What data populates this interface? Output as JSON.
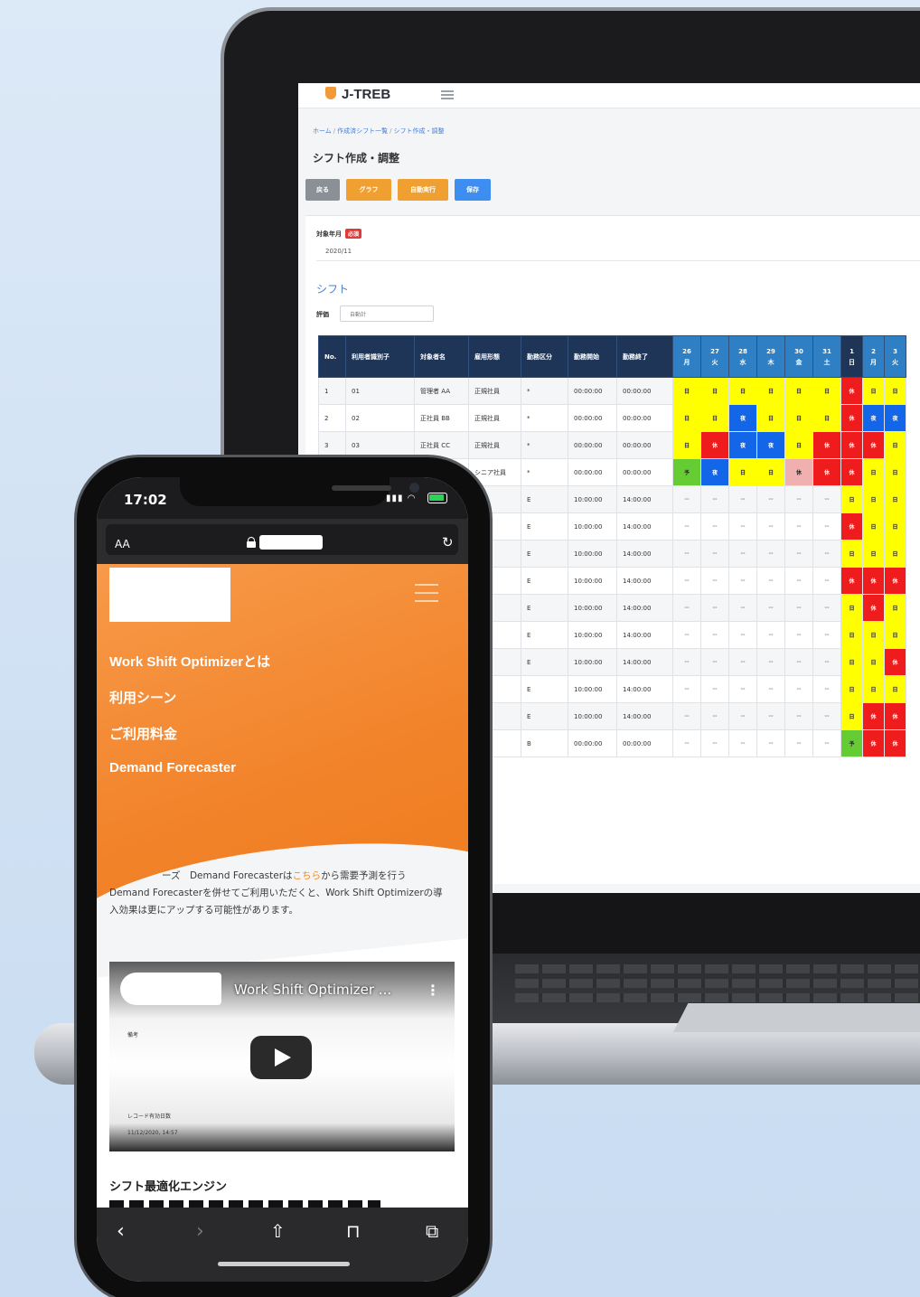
{
  "laptop": {
    "brand": "J-TREB",
    "breadcrumb": [
      "ホーム",
      "作成済シフト一覧",
      "シフト作成・調整"
    ],
    "page_title": "シフト作成・調整",
    "buttons": {
      "back": "戻る",
      "graph": "グラフ",
      "auto": "自動実行",
      "save": "保存"
    },
    "target_month_label": "対象年月",
    "required_badge": "必須",
    "target_month_value": "2020/11",
    "section_title": "シフト",
    "eval_label": "評価",
    "eval_placeholder": "自動計",
    "table": {
      "headers": [
        "No.",
        "利用者識別子",
        "対象者名",
        "雇用形態",
        "勤務区分",
        "勤務開始",
        "勤務終了"
      ],
      "days": [
        {
          "d": "26",
          "w": "月"
        },
        {
          "d": "27",
          "w": "火"
        },
        {
          "d": "28",
          "w": "水"
        },
        {
          "d": "29",
          "w": "木"
        },
        {
          "d": "30",
          "w": "金"
        },
        {
          "d": "31",
          "w": "土"
        },
        {
          "d": "1",
          "w": "日"
        },
        {
          "d": "2",
          "w": "月"
        },
        {
          "d": "3",
          "w": "火"
        }
      ],
      "rows": [
        {
          "no": "1",
          "id": "01",
          "name": "管理者 AA",
          "type": "正規社員",
          "div": "*",
          "start": "00:00:00",
          "end": "00:00:00"
        },
        {
          "no": "2",
          "id": "02",
          "name": "正社員 BB",
          "type": "正規社員",
          "div": "*",
          "start": "00:00:00",
          "end": "00:00:00"
        },
        {
          "no": "3",
          "id": "03",
          "name": "正社員 CC",
          "type": "正規社員",
          "div": "*",
          "start": "00:00:00",
          "end": "00:00:00"
        },
        {
          "no": "",
          "id": "",
          "name": "",
          "type": "シニア社員",
          "div": "*",
          "start": "00:00:00",
          "end": "00:00:00"
        },
        {
          "no": "",
          "id": "",
          "name": "",
          "type": "ート",
          "div": "E",
          "start": "10:00:00",
          "end": "14:00:00"
        },
        {
          "no": "",
          "id": "",
          "name": "",
          "type": "ート",
          "div": "E",
          "start": "10:00:00",
          "end": "14:00:00"
        },
        {
          "no": "",
          "id": "",
          "name": "",
          "type": "ート",
          "div": "E",
          "start": "10:00:00",
          "end": "14:00:00"
        },
        {
          "no": "",
          "id": "",
          "name": "",
          "type": "ート",
          "div": "E",
          "start": "10:00:00",
          "end": "14:00:00"
        },
        {
          "no": "",
          "id": "",
          "name": "",
          "type": "ート",
          "div": "E",
          "start": "10:00:00",
          "end": "14:00:00"
        },
        {
          "no": "",
          "id": "",
          "name": "",
          "type": "ート",
          "div": "E",
          "start": "10:00:00",
          "end": "14:00:00"
        },
        {
          "no": "",
          "id": "",
          "name": "",
          "type": "ト",
          "div": "E",
          "start": "10:00:00",
          "end": "14:00:00"
        },
        {
          "no": "",
          "id": "",
          "name": "",
          "type": "ト",
          "div": "E",
          "start": "10:00:00",
          "end": "14:00:00"
        },
        {
          "no": "",
          "id": "",
          "name": "",
          "type": "ト",
          "div": "E",
          "start": "10:00:00",
          "end": "14:00:00"
        },
        {
          "no": "",
          "id": "",
          "name": "",
          "type": "",
          "div": "B",
          "start": "00:00:00",
          "end": "00:00:00"
        }
      ],
      "cells": [
        [
          [
            "y",
            "日"
          ],
          [
            "y",
            "日"
          ],
          [
            "y",
            "日"
          ],
          [
            "y",
            "日"
          ],
          [
            "y",
            "日"
          ],
          [
            "y",
            "日"
          ],
          [
            "r",
            "休"
          ],
          [
            "y",
            "日"
          ],
          [
            "y",
            "日"
          ]
        ],
        [
          [
            "y",
            "日"
          ],
          [
            "y",
            "日"
          ],
          [
            "b",
            "夜"
          ],
          [
            "y",
            "日"
          ],
          [
            "y",
            "日"
          ],
          [
            "y",
            "日"
          ],
          [
            "r",
            "休"
          ],
          [
            "b",
            "夜"
          ],
          [
            "b",
            "夜"
          ]
        ],
        [
          [
            "y",
            "日"
          ],
          [
            "r",
            "休"
          ],
          [
            "b",
            "夜"
          ],
          [
            "b",
            "夜"
          ],
          [
            "y",
            "日"
          ],
          [
            "r",
            "休"
          ],
          [
            "r",
            "休"
          ],
          [
            "r",
            "休"
          ],
          [
            "y",
            "日"
          ]
        ],
        [
          [
            "g",
            "予"
          ],
          [
            "b",
            "夜"
          ],
          [
            "y",
            "日"
          ],
          [
            "y",
            "日"
          ],
          [
            "p",
            "休"
          ],
          [
            "r",
            "休"
          ],
          [
            "r",
            "休"
          ],
          [
            "y",
            "日"
          ],
          [
            "y",
            "日"
          ]
        ],
        [
          [
            "d",
            "--"
          ],
          [
            "d",
            "--"
          ],
          [
            "d",
            "--"
          ],
          [
            "d",
            "--"
          ],
          [
            "d",
            "--"
          ],
          [
            "d",
            "--"
          ],
          [
            "y",
            "日"
          ],
          [
            "y",
            "日"
          ],
          [
            "y",
            "日"
          ]
        ],
        [
          [
            "d",
            "--"
          ],
          [
            "d",
            "--"
          ],
          [
            "d",
            "--"
          ],
          [
            "d",
            "--"
          ],
          [
            "d",
            "--"
          ],
          [
            "d",
            "--"
          ],
          [
            "r",
            "休"
          ],
          [
            "y",
            "日"
          ],
          [
            "y",
            "日"
          ]
        ],
        [
          [
            "d",
            "--"
          ],
          [
            "d",
            "--"
          ],
          [
            "d",
            "--"
          ],
          [
            "d",
            "--"
          ],
          [
            "d",
            "--"
          ],
          [
            "d",
            "--"
          ],
          [
            "y",
            "日"
          ],
          [
            "y",
            "日"
          ],
          [
            "y",
            "日"
          ]
        ],
        [
          [
            "d",
            "--"
          ],
          [
            "d",
            "--"
          ],
          [
            "d",
            "--"
          ],
          [
            "d",
            "--"
          ],
          [
            "d",
            "--"
          ],
          [
            "d",
            "--"
          ],
          [
            "r",
            "休"
          ],
          [
            "r",
            "休"
          ],
          [
            "r",
            "休"
          ]
        ],
        [
          [
            "d",
            "--"
          ],
          [
            "d",
            "--"
          ],
          [
            "d",
            "--"
          ],
          [
            "d",
            "--"
          ],
          [
            "d",
            "--"
          ],
          [
            "d",
            "--"
          ],
          [
            "y",
            "日"
          ],
          [
            "r",
            "休"
          ],
          [
            "y",
            "日"
          ]
        ],
        [
          [
            "d",
            "--"
          ],
          [
            "d",
            "--"
          ],
          [
            "d",
            "--"
          ],
          [
            "d",
            "--"
          ],
          [
            "d",
            "--"
          ],
          [
            "d",
            "--"
          ],
          [
            "y",
            "日"
          ],
          [
            "y",
            "日"
          ],
          [
            "y",
            "日"
          ]
        ],
        [
          [
            "d",
            "--"
          ],
          [
            "d",
            "--"
          ],
          [
            "d",
            "--"
          ],
          [
            "d",
            "--"
          ],
          [
            "d",
            "--"
          ],
          [
            "d",
            "--"
          ],
          [
            "y",
            "日"
          ],
          [
            "y",
            "日"
          ],
          [
            "r",
            "休"
          ]
        ],
        [
          [
            "d",
            "--"
          ],
          [
            "d",
            "--"
          ],
          [
            "d",
            "--"
          ],
          [
            "d",
            "--"
          ],
          [
            "d",
            "--"
          ],
          [
            "d",
            "--"
          ],
          [
            "y",
            "日"
          ],
          [
            "y",
            "日"
          ],
          [
            "y",
            "日"
          ]
        ],
        [
          [
            "d",
            "--"
          ],
          [
            "d",
            "--"
          ],
          [
            "d",
            "--"
          ],
          [
            "d",
            "--"
          ],
          [
            "d",
            "--"
          ],
          [
            "d",
            "--"
          ],
          [
            "y",
            "日"
          ],
          [
            "r",
            "休"
          ],
          [
            "r",
            "休"
          ]
        ],
        [
          [
            "d",
            "--"
          ],
          [
            "d",
            "--"
          ],
          [
            "d",
            "--"
          ],
          [
            "d",
            "--"
          ],
          [
            "d",
            "--"
          ],
          [
            "d",
            "--"
          ],
          [
            "g",
            "予"
          ],
          [
            "r",
            "休"
          ],
          [
            "r",
            "休"
          ]
        ]
      ]
    }
  },
  "phone": {
    "time": "17:02",
    "aa": "AA",
    "nav": [
      "Work Shift Optimizerとは",
      "利用シーン",
      "ご利用料金",
      "Demand Forecaster"
    ],
    "promo": {
      "prefix": "ーズ　Demand Forecasterは",
      "link": "こちら",
      "rest": "から需要予測を行うDemand Forecasterを併せてご利用いただくと、Work Shift Optimizerの導入効果は更にアップする可能性があります。"
    },
    "video": {
      "title": "Work Shift Optimizer ...",
      "label_memo": "備考",
      "label_record": "レコード有効日数",
      "datetime": "11/12/2020, 14:57"
    },
    "engine_heading": "シフト最適化エンジン"
  },
  "colors": {
    "orange": "#f2832a",
    "header_navy": "#1e3557",
    "day_blue": "#2e7fc4",
    "cell_yellow": "#ffff00",
    "cell_red": "#ee1c1c",
    "cell_blue": "#1466e8",
    "cell_green": "#66cc33",
    "button_orange": "#f0a030",
    "button_blue": "#3d8ef0"
  }
}
